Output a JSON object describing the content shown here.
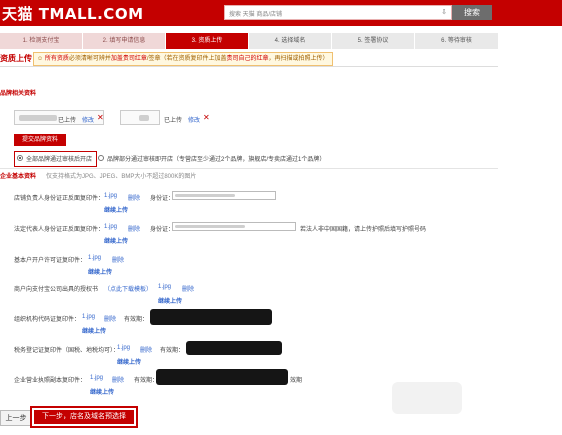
{
  "header": {
    "logo": "天猫 TMALL.COM",
    "search_placeholder": "搜索 天猫 商品/店铺",
    "search_button": "搜索"
  },
  "steps": [
    "1. 检测支付宝",
    "2. 填写申请信息",
    "3. 资质上传",
    "4. 选择域名",
    "5. 签署协议",
    "6. 等待审核"
  ],
  "page_title": "资质上传",
  "notice": {
    "prefix": "所有资质",
    "middle": "必须清晰可辨并",
    "red1": "加盖贵司红章",
    "middle2": "/签章（若在资质复印件上加盖",
    "red2": "贵司自己的红章",
    "suffix": "，再扫描或拍照上传）"
  },
  "brand_section": {
    "label": "品牌相关资料",
    "items": [
      {
        "status": "已上传",
        "modify": "修改"
      },
      {
        "status": "已上传",
        "modify": "修改"
      }
    ],
    "submit_button": "提交品牌资料",
    "radio_all": "全部品牌通过审核后开店",
    "radio_partial": "品牌部分通过审核即开店（专营店至少通过2个品牌，旗舰店/专卖店通过1个品牌）"
  },
  "company_section": {
    "label": "企业基本资料",
    "hint": "仅支持格式为JPG、JPEG、BMP大小不超过800K的图片",
    "id_label": "身份证：",
    "validity_label": "有效期：",
    "delete_label": "删除",
    "continue_label": "继续上传",
    "rows": [
      {
        "label": "店铺负责人身份证正反面复印件：",
        "file": "1.jpg"
      },
      {
        "label": "法定代表人身份证正反面复印件：",
        "file": "1.jpg",
        "extra": "若法人非中国国籍，请上传护照后填写护照号码"
      },
      {
        "label": "基本户开户许可证复印件：",
        "file": "1.jpg"
      },
      {
        "label": "商户向支付宝公司出具的授权书",
        "link": "（点此下载模板）",
        "file": "1.jpg"
      },
      {
        "label": "组织机构代码证复印件：",
        "file": "1.jpg"
      },
      {
        "label": "税务登记证复印件（国税、地税均可）：",
        "file": "1.jpg"
      },
      {
        "label": "企业营业执照副本复印件：",
        "file": "1.jpg",
        "suffix": "效期"
      }
    ]
  },
  "footer": {
    "prev_button": "上一步",
    "next_button": "下一步，店名及域名预选择"
  }
}
